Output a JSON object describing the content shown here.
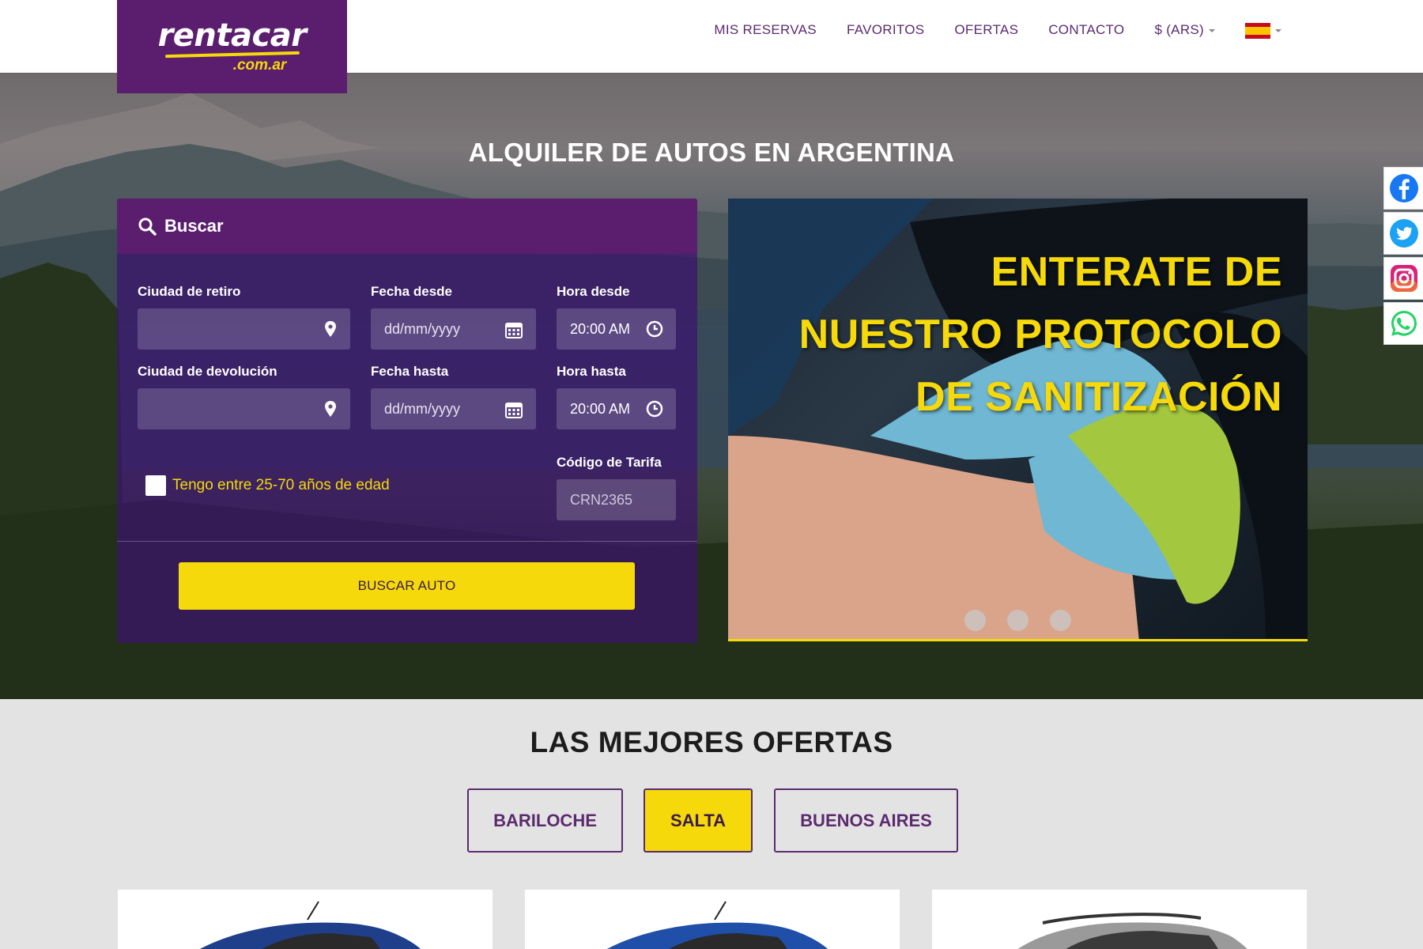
{
  "header": {
    "logo": {
      "main": "rentacar",
      "sub": ".com.ar"
    },
    "nav": [
      {
        "label": "MIS RESERVAS"
      },
      {
        "label": "FAVORITOS"
      },
      {
        "label": "OFERTAS"
      },
      {
        "label": "CONTACTO"
      },
      {
        "label": "$ (ARS)"
      }
    ],
    "language_flag": "spain-flag-icon"
  },
  "hero": {
    "title": "ALQUILER DE AUTOS EN ARGENTINA"
  },
  "search": {
    "header_label": "Buscar",
    "labels": {
      "pickup_city": "Ciudad de retiro",
      "date_from": "Fecha desde",
      "time_from": "Hora desde",
      "return_city": "Ciudad de devolución",
      "date_to": "Fecha hasta",
      "time_to": "Hora hasta",
      "rate_code": "Código de Tarifa"
    },
    "fields": {
      "pickup_city": "",
      "date_from_placeholder": "dd/mm/yyyy",
      "time_from": "20:00 AM",
      "return_city": "",
      "date_to_placeholder": "dd/mm/yyyy",
      "time_to": "20:00 AM",
      "rate_code_placeholder": "CRN2365"
    },
    "age_checkbox": {
      "label": "Tengo entre 25-70 años de edad",
      "checked": false
    },
    "submit_label": "BUSCAR AUTO"
  },
  "banner": {
    "lines": [
      "ENTERATE DE",
      "NUESTRO PROTOCOLO",
      "DE SANITIZACIÓN"
    ],
    "slides": 3
  },
  "social": [
    "facebook-icon",
    "twitter-icon",
    "instagram-icon",
    "whatsapp-icon"
  ],
  "offers": {
    "title": "LAS MEJORES OFERTAS",
    "tabs": [
      {
        "label": "BARILOCHE",
        "active": false
      },
      {
        "label": "SALTA",
        "active": true
      },
      {
        "label": "BUENOS AIRES",
        "active": false
      }
    ]
  },
  "colors": {
    "brand_purple": "#5b1e6e",
    "brand_yellow": "#f5d90a"
  }
}
